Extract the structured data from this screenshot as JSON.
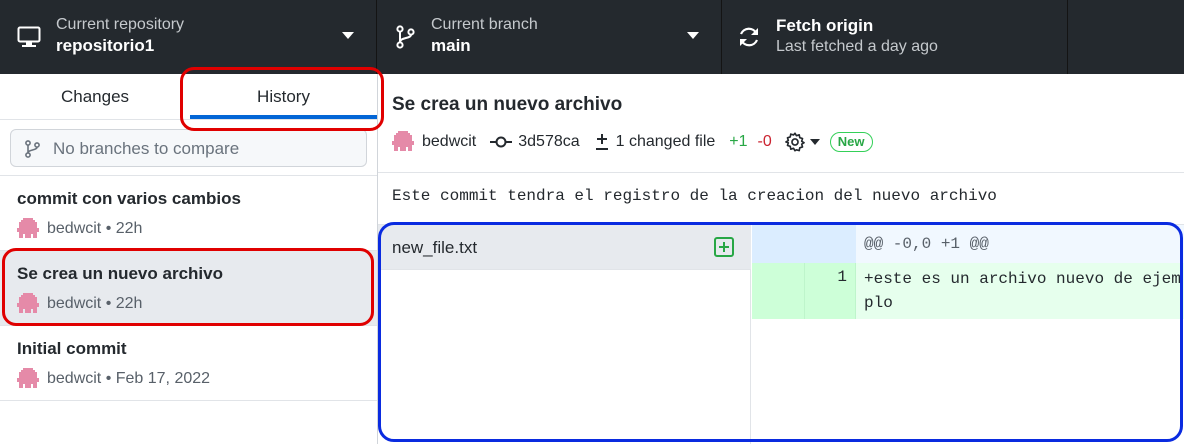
{
  "toolbar": {
    "repository": {
      "label": "Current repository",
      "value": "repositorio1",
      "icon": "computer-icon"
    },
    "branch": {
      "label": "Current branch",
      "value": "main",
      "icon": "git-branch-icon"
    },
    "fetch": {
      "label": "Fetch origin",
      "status": "Last fetched a day ago",
      "icon": "sync-icon"
    }
  },
  "sidebar": {
    "tabs": [
      {
        "label": "Changes",
        "selected": false
      },
      {
        "label": "History",
        "selected": true
      }
    ],
    "compare": {
      "placeholder": "No branches to compare",
      "icon": "git-branch-icon"
    },
    "commits": [
      {
        "title": "commit con varios cambios",
        "meta": "bedwcit • 22h",
        "selected": false
      },
      {
        "title": "Se crea un nuevo archivo",
        "meta": "bedwcit • 22h",
        "selected": true
      },
      {
        "title": "Initial commit",
        "meta": "bedwcit • Feb 17, 2022",
        "selected": false
      }
    ]
  },
  "commit_detail": {
    "title": "Se crea un nuevo archivo",
    "author": "bedwcit",
    "sha": "3d578ca",
    "changed_files": "1 changed file",
    "additions": "+1",
    "deletions": "-0",
    "badge": "New",
    "body": "Este commit tendra el registro de la creacion del nuevo archivo"
  },
  "files": [
    {
      "name": "new_file.txt",
      "status": "added",
      "icon": "file-added-icon"
    }
  ],
  "diff": {
    "hunk_header": "@@ -0,0 +1 @@",
    "lines": [
      {
        "new_line_no": "1",
        "text": "+este es un archivo nuevo de ejemplo"
      }
    ]
  },
  "colors": {
    "toolbar_bg": "#24292e",
    "accent": "#0366d6",
    "added": "#28a745",
    "removed": "#cb2431",
    "annotation_red": "#e00000",
    "annotation_blue": "#0a2be0"
  }
}
